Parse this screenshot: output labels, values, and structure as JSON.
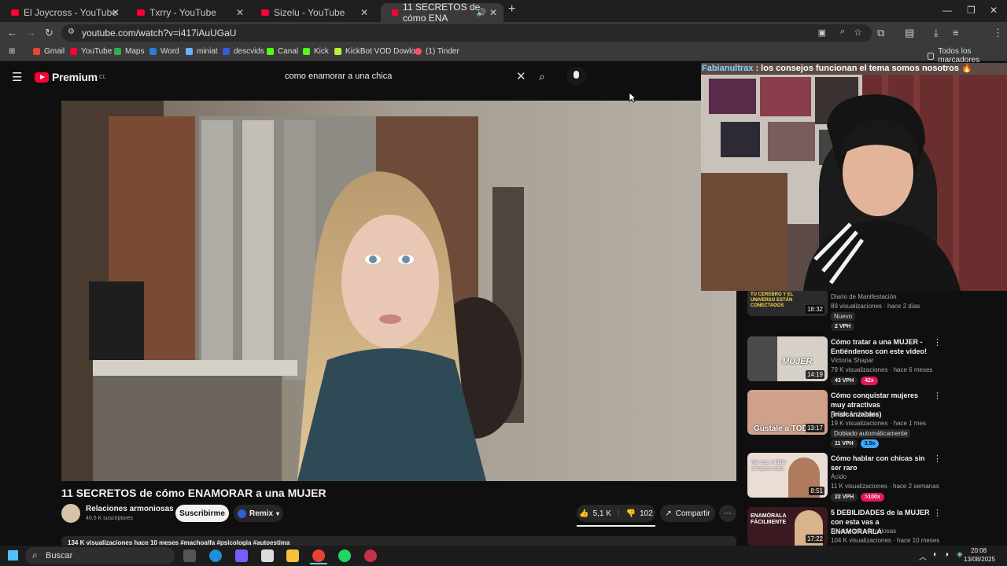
{
  "browser": {
    "tabs": [
      {
        "label": "El Joycross - YouTube"
      },
      {
        "label": "Txrry - YouTube"
      },
      {
        "label": "Sizelu - YouTube"
      },
      {
        "label": "11 SECRETOS de cómo ENA"
      }
    ],
    "url": "youtube.com/watch?v=i417iAuUGaU",
    "bookmarks": [
      "Gmail",
      "YouTube",
      "Maps",
      "Word",
      "miniat",
      "descvids",
      "Canal",
      "Kick",
      "KickBot VOD Dowlo...",
      "(1) Tinder"
    ],
    "all_bookmarks": "Todos los marcadores"
  },
  "youtube": {
    "logo": "Premium",
    "logo_country": "CL",
    "search_value": "como enamorar a una chica",
    "video_title": "11 SECRETOS de cómo ENAMORAR a una MUJER",
    "channel": {
      "name": "Relaciones armoniosas",
      "subscribers": "40,5 K suscriptores"
    },
    "subscribe_label": "Suscribirme",
    "remix_label": "Remix",
    "likes": "5,1 K",
    "dislikes": "102",
    "share_label": "Compartir",
    "description_preview": "134 K visualizaciones  hace 10 meses  #machoalfa #psicologia #autoestima"
  },
  "overlay": {
    "chat_user": "Fabianultrax",
    "chat_message": " : los consejos funcionan el tema somos nosotros 🔥"
  },
  "recommendations": [
    {
      "title": "",
      "channel": "Diario de Manifestación",
      "meta": "89 visualizaciones · hace 2 días",
      "badge": "Nuevo",
      "duration": "18:32",
      "vph": "2 VPH",
      "mult": "",
      "thumb_text": "TU CEREBRO Y EL UNIVERSO ESTÁN CONECTADOS"
    },
    {
      "title": "Cómo tratar a una MUJER - Entiéndenos con este video!",
      "channel": "Victoria Shapar",
      "meta": "79 K visualizaciones · hace 6 meses",
      "badge": "",
      "duration": "14:19",
      "vph": "43 VPH",
      "mult": "42x",
      "thumb_text": "MUJER"
    },
    {
      "title": "Cómo conquistar mujeres muy atractivas (inalcanzables)",
      "channel": "Felipe Arciniegas",
      "meta": "19 K visualizaciones · hace 1 mes",
      "badge": "Doblado automáticamente",
      "duration": "13:17",
      "vph": "11 VPH",
      "mult": "3.5x",
      "thumb_text": "Gústale a TODAS"
    },
    {
      "title": "Cómo hablar con chicas sin ser raro",
      "channel": "Ácido",
      "meta": "11 K visualizaciones · hace 2 semanas",
      "badge": "",
      "duration": "8:51",
      "vph": "22 VPH",
      "mult": ">100x",
      "thumb_text": "No vas a fallar si haces esto"
    },
    {
      "title": "5 DEBILIDADES de la MUJER con esta vas a ENAMORARLA",
      "channel": "Relaciones armoniosas",
      "meta": "104 K visualizaciones · hace 10 meses",
      "badge": "",
      "duration": "17:22",
      "vph": "",
      "mult": "",
      "thumb_text": "ENAMÓRALA FÁCILMENTE"
    }
  ],
  "taskbar": {
    "search_label": "Buscar",
    "time": "20:08",
    "date": "13/08/2025"
  },
  "colors": {
    "accent_red": "#ff0033",
    "mult_blue": "#3ea6ff",
    "mult_red": "#e3165b"
  }
}
